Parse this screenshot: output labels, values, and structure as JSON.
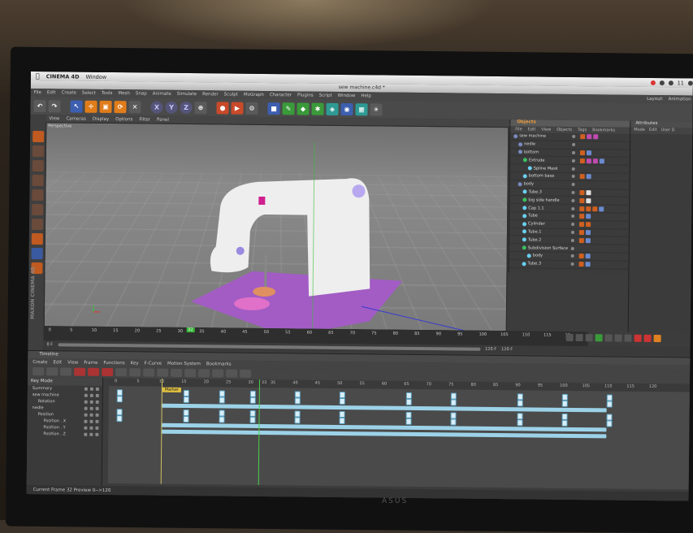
{
  "menubar": {
    "apple": "",
    "app": "CINEMA 4D",
    "items": [
      "Window"
    ],
    "clock": "11"
  },
  "window": {
    "title": "sew machine.c4d *"
  },
  "c4d_menu": [
    "File",
    "Edit",
    "Create",
    "Select",
    "Tools",
    "Mesh",
    "Snap",
    "Animate",
    "Simulate",
    "Render",
    "Sculpt",
    "MoGraph",
    "Character",
    "Plugins",
    "Script",
    "Window",
    "Help"
  ],
  "c4d_menu_right": [
    "Layout:",
    "Animation"
  ],
  "toolbar": {
    "axis": [
      "X",
      "Y",
      "Z"
    ]
  },
  "viewport": {
    "menu": [
      "View",
      "Cameras",
      "Display",
      "Options",
      "Filter",
      "Panel"
    ],
    "label": "Perspective",
    "ruler_ticks": [
      "0",
      "5",
      "10",
      "15",
      "20",
      "25",
      "30",
      "35",
      "40",
      "45",
      "50",
      "55",
      "60",
      "65",
      "70",
      "75",
      "80",
      "85",
      "90",
      "95",
      "100",
      "105",
      "110",
      "115",
      "12"
    ],
    "current_frame_box": "32",
    "start": "0 F",
    "end_a": "120 F",
    "end_b": "120 F"
  },
  "objects": {
    "title": "Objects",
    "menu": [
      "File",
      "Edit",
      "View",
      "Objects",
      "Tags",
      "Bookmarks"
    ],
    "rows": [
      {
        "name": "sew machine",
        "indent": 0
      },
      {
        "name": "nedle",
        "indent": 1
      },
      {
        "name": "bottom",
        "indent": 1
      },
      {
        "name": "Extrude",
        "indent": 2
      },
      {
        "name": "Spline Mask",
        "indent": 3
      },
      {
        "name": "bottom base",
        "indent": 2
      },
      {
        "name": "body",
        "indent": 1
      },
      {
        "name": "Tube.3",
        "indent": 2
      },
      {
        "name": "big side handle",
        "indent": 2
      },
      {
        "name": "Cap 1.1",
        "indent": 2
      },
      {
        "name": "Tube",
        "indent": 2
      },
      {
        "name": "Cylinder",
        "indent": 2
      },
      {
        "name": "Tube.1",
        "indent": 2
      },
      {
        "name": "Tube.2",
        "indent": 2
      },
      {
        "name": "Subdivision Surface",
        "indent": 2
      },
      {
        "name": "body",
        "indent": 3
      },
      {
        "name": "Tube.3",
        "indent": 2
      }
    ]
  },
  "attributes": {
    "title": "Attributes",
    "menu": [
      "Mode",
      "Edit",
      "User D"
    ]
  },
  "timeline": {
    "title": "Timeline",
    "menu": [
      "Create",
      "Edit",
      "View",
      "Frame",
      "Functions",
      "Key",
      "F-Curve",
      "Motion System",
      "Bookmarks"
    ],
    "left_header": "Key Mode",
    "tracks": [
      {
        "name": "Summary",
        "indent": 0
      },
      {
        "name": "sew machine",
        "indent": 0
      },
      {
        "name": "Rotation",
        "indent": 1
      },
      {
        "name": "nedle",
        "indent": 0
      },
      {
        "name": "Position",
        "indent": 1
      },
      {
        "name": "Position . X",
        "indent": 2
      },
      {
        "name": "Position . Y",
        "indent": 2
      },
      {
        "name": "Position . Z",
        "indent": 2
      }
    ],
    "ruler": [
      "0",
      "5",
      "10",
      "15",
      "20",
      "25",
      "30",
      "33",
      "35",
      "40",
      "45",
      "50",
      "55",
      "60",
      "65",
      "70",
      "75",
      "80",
      "85",
      "90",
      "95",
      "100",
      "105",
      "110",
      "115",
      "120"
    ],
    "marker": "Marker",
    "current_frame": 32,
    "status": "Current Frame  32  Preview  0-->120"
  },
  "colors": {
    "accent": "#f0a040",
    "key": "#9cd2e8",
    "cursor": "#4ad04a",
    "machine_body": "#eeeeee",
    "base": "#a060c0"
  }
}
